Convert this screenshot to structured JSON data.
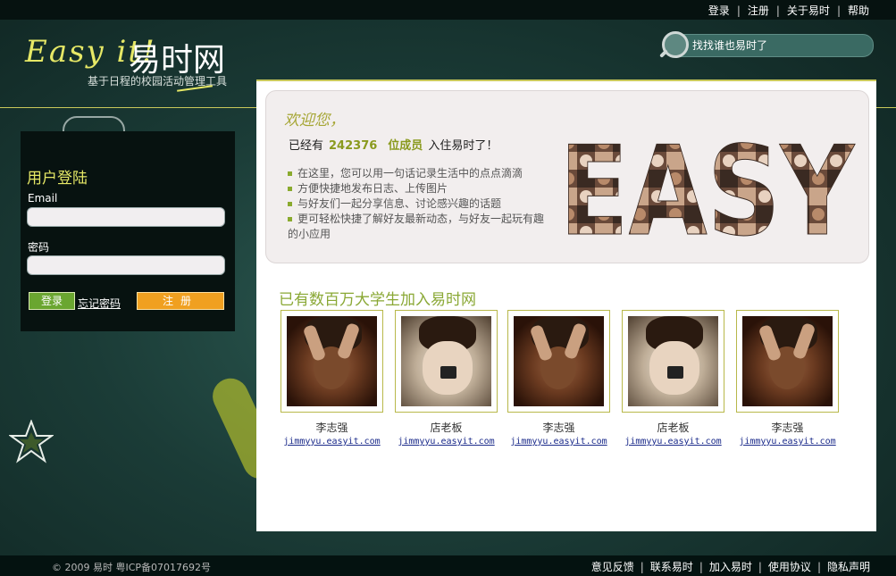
{
  "top_nav": {
    "items": [
      "登录",
      "注册",
      "关于易时",
      "帮助"
    ],
    "separator": "|"
  },
  "logo": {
    "easy": "Easy it!",
    "cn": "易时网",
    "subtitle": "基于日程的校园活动管理工具"
  },
  "search": {
    "placeholder": "找找谁也易时了"
  },
  "login": {
    "title": "用户登陆",
    "email_label": "Email",
    "password_label": "密码",
    "login_button": "登录",
    "forgot": "忘记密码",
    "register_button": "注册"
  },
  "welcome": {
    "title": "欢迎您，",
    "prefix": "已经有",
    "count": "242376",
    "unit": "位成员",
    "suffix": "入住易时了！",
    "features": [
      "在这里，您可以用一句话记录生活中的点点滴滴",
      "方便快捷地发布日志、上传图片",
      "与好友们一起分享信息、讨论感兴趣的话题",
      "更可轻松快捷了解好友最新动态，与好友一起玩有趣的小应用"
    ],
    "collage_text": "EASY"
  },
  "join": {
    "title": "已有数百万大学生加入易时网",
    "members": [
      {
        "name": "李志强",
        "link": "jimmyyu.easyit.com",
        "photo": "a"
      },
      {
        "name": "店老板",
        "link": "jimmyyu.easyit.com",
        "photo": "b"
      },
      {
        "name": "李志强",
        "link": "jimmyyu.easyit.com",
        "photo": "a"
      },
      {
        "name": "店老板",
        "link": "jimmyyu.easyit.com",
        "photo": "b"
      },
      {
        "name": "李志强",
        "link": "jimmyyu.easyit.com",
        "photo": "a"
      }
    ]
  },
  "footer": {
    "copyright": "© 2009 易时 粤ICP备07017692号",
    "links": [
      "意见反馈",
      "联系易时",
      "加入易时",
      "使用协议",
      "隐私声明"
    ]
  },
  "colors": {
    "accent": "#e6e866",
    "green": "#8aa835",
    "orange": "#f0a020",
    "login_green": "#6aa630"
  }
}
